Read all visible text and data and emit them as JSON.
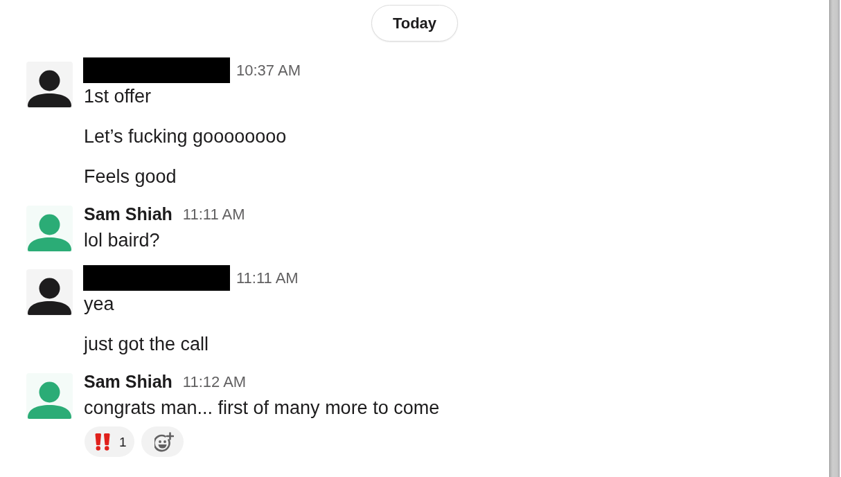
{
  "date_divider": {
    "label": "Today"
  },
  "messages": [
    {
      "redacted_name": true,
      "avatar": {
        "color": "#1d1c1d"
      },
      "time": "10:37 AM",
      "lines": [
        "1st offer",
        "Let’s fucking goooooooo",
        "Feels good"
      ]
    },
    {
      "author": "Sam Shiah",
      "redacted_name": false,
      "avatar": {
        "color": "#2bac76"
      },
      "time": "11:11 AM",
      "lines": [
        "lol baird?"
      ]
    },
    {
      "redacted_name": true,
      "avatar": {
        "color": "#1d1c1d"
      },
      "time": "11:11 AM",
      "lines": [
        "yea",
        "just got the call"
      ]
    },
    {
      "author": "Sam Shiah",
      "redacted_name": false,
      "avatar": {
        "color": "#2bac76"
      },
      "time": "11:12 AM",
      "lines": [
        "congrats man... first of many more to come"
      ],
      "reactions": [
        {
          "count": "1"
        }
      ]
    }
  ]
}
